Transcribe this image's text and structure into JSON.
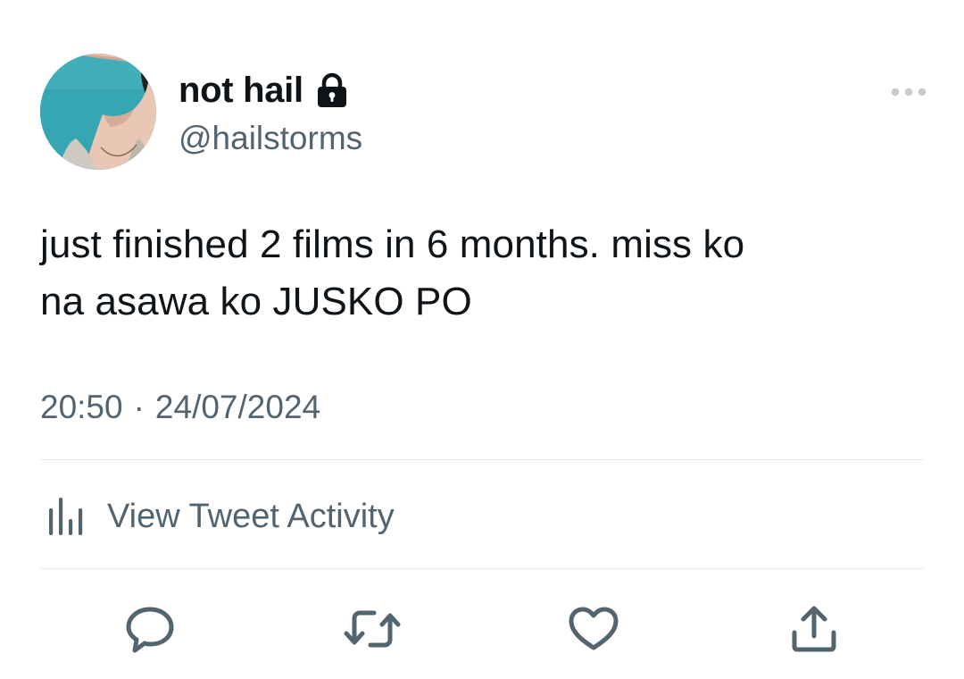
{
  "tweet": {
    "author": {
      "display_name": "not hail",
      "handle": "@hailstorms",
      "protected": true
    },
    "text_lines": [
      "just finished 2 films in 6 months. miss ko",
      "na asawa ko JUSKO PO"
    ],
    "time": "20:50",
    "separator": "·",
    "date": "24/07/2024",
    "activity_label": "View Tweet Activity",
    "actions": [
      "reply-icon",
      "retweet-icon",
      "like-icon",
      "share-icon"
    ]
  },
  "colors": {
    "text": "#0f1419",
    "secondary": "#536471",
    "divider": "#e6e9eb",
    "background": "#ffffff"
  }
}
